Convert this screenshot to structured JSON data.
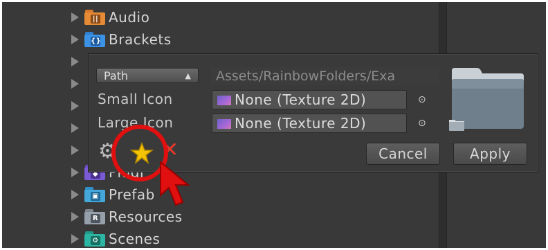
{
  "tree": {
    "items": [
      {
        "label": "Audio",
        "icon": "audio-folder-icon"
      },
      {
        "label": "Brackets",
        "icon": "brackets-folder-icon"
      },
      {
        "label": "",
        "icon": ""
      },
      {
        "label": "",
        "icon": ""
      },
      {
        "label": "",
        "icon": ""
      },
      {
        "label": "",
        "icon": ""
      },
      {
        "label": "",
        "icon": ""
      },
      {
        "label": "Plugi",
        "icon": "plugins-folder-icon"
      },
      {
        "label": "Prefab",
        "icon": "prefabs-folder-icon"
      },
      {
        "label": "Resources",
        "icon": "resources-folder-icon"
      },
      {
        "label": "Scenes",
        "icon": "scenes-folder-icon"
      }
    ]
  },
  "popup": {
    "mode_select": {
      "value": "Path",
      "options_icon": "up-down-arrows-icon"
    },
    "path_value": "Assets/RainbowFolders/Exa",
    "small_icon": {
      "label": "Small Icon",
      "value": "None (Texture 2D)"
    },
    "large_icon": {
      "label": "Large Icon",
      "value": "None (Texture 2D)"
    },
    "buttons": {
      "cancel": "Cancel",
      "apply": "Apply"
    },
    "icons": [
      "gear-icon",
      "star-icon",
      "delete-x-icon",
      "object-picker-icon"
    ]
  },
  "colors": {
    "background": "#393939",
    "highlight_circle": "#e01010",
    "star": "#f5c400",
    "delete": "#e23a2a"
  }
}
